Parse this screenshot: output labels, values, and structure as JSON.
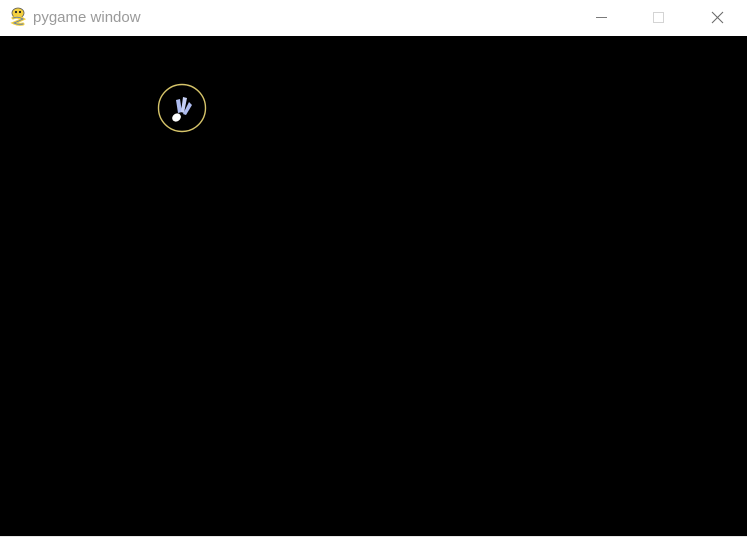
{
  "window": {
    "title": "pygame window",
    "app_icon": "pygame-snake-icon",
    "controls": {
      "minimize_icon": "minimize-icon",
      "maximize_icon": "maximize-icon",
      "close_icon": "close-icon"
    }
  },
  "game": {
    "background_color": "#000000",
    "sprite": {
      "icon": "shuttlecock-icon",
      "ring_color": "#d6c46a",
      "feather_color": "#aebcf0"
    }
  }
}
